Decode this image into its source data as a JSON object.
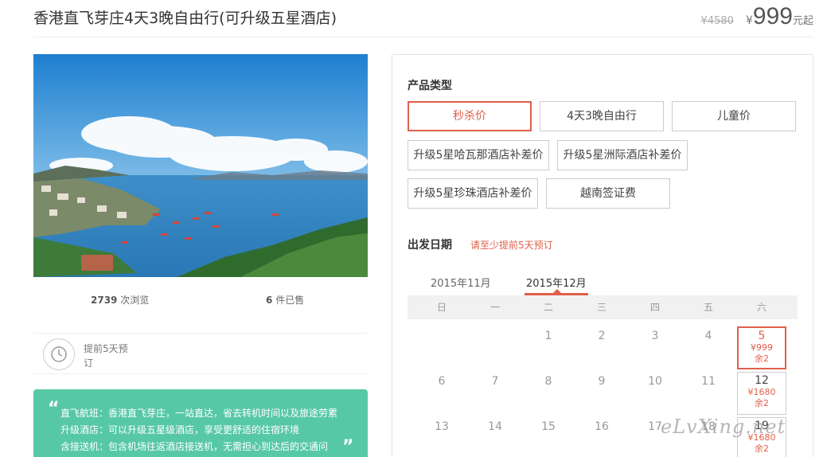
{
  "header": {
    "title": "香港直飞芽庄4天3晚自由行(可升级五星酒店)",
    "old_price": "¥4580",
    "currency": "¥",
    "price": "999",
    "price_suffix": "元起"
  },
  "stats": {
    "views_count": "2739",
    "views_label": "次浏览",
    "sold_count": "6",
    "sold_label": "件已售"
  },
  "advance_booking": {
    "icon": "clock-icon",
    "text": "提前5天预订"
  },
  "highlights": {
    "lines": [
      "直飞航班：香港直飞芽庄，一站直达，省去转机时间以及旅途劳累",
      "升级酒店：可以升级五星级酒店，享受更舒适的住宿环境",
      "含接送机：包含机场往返酒店接送机，无需担心到达后的交通问"
    ]
  },
  "product_types": {
    "label": "产品类型",
    "options": [
      "秒杀价",
      "4天3晚自由行",
      "儿童价",
      "升级5星哈瓦那酒店补差价",
      "升级5星洲际酒店补差价",
      "升级5星珍珠酒店补差价",
      "越南签证费"
    ],
    "selected_index": 0
  },
  "departure": {
    "label": "出发日期",
    "note": "请至少提前5天预订",
    "months": [
      "2015年11月",
      "2015年12月"
    ],
    "active_month_index": 1,
    "weekdays": [
      "日",
      "一",
      "二",
      "三",
      "四",
      "五",
      "六"
    ],
    "days": {
      "d1": "1",
      "d2": "2",
      "d3": "3",
      "d4": "4",
      "d6": "6",
      "d7": "7",
      "d8": "8",
      "d9": "9",
      "d10": "10",
      "d11": "11",
      "d13": "13",
      "d14": "14",
      "d15": "15",
      "d16": "16",
      "d17": "17",
      "d18": "18"
    },
    "available": [
      {
        "date": "5",
        "price": "¥999",
        "left": "余2"
      },
      {
        "date": "12",
        "price": "¥1680",
        "left": "余2"
      },
      {
        "date": "19",
        "price": "¥1680",
        "left": "余2"
      }
    ]
  },
  "watermark": "eLvXing.net",
  "colors": {
    "accent": "#e0604b",
    "highlight_bg": "#57c8a6"
  }
}
